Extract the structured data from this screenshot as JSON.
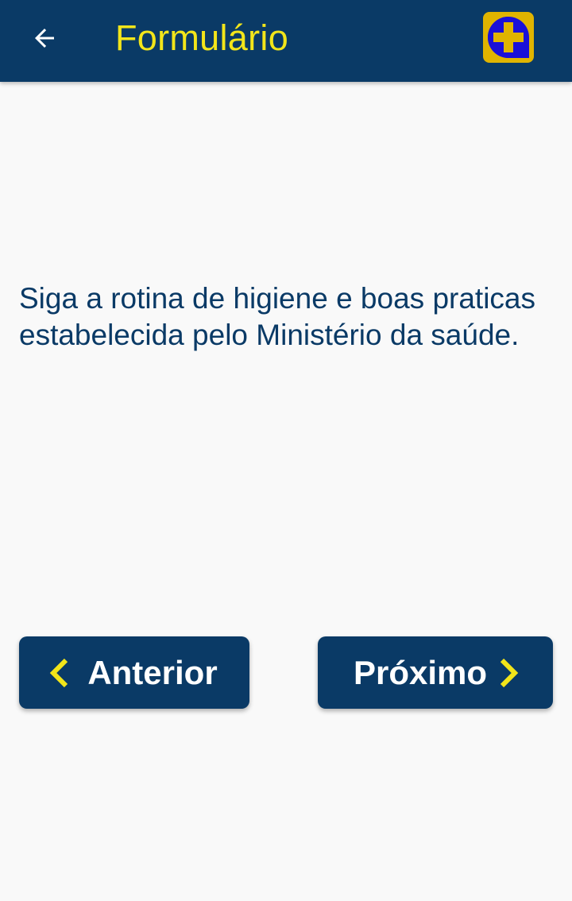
{
  "app_bar": {
    "title": "Formulário",
    "back_icon": "arrow-left-icon",
    "logo_icon": "medical-cross-logo-icon"
  },
  "content": {
    "message": "Siga a rotina de higiene e boas praticas estabelecida pelo Ministério da saúde."
  },
  "navigation": {
    "previous_label": "Anterior",
    "next_label": "Próximo",
    "previous_icon": "chevron-left-icon",
    "next_icon": "chevron-right-icon"
  },
  "colors": {
    "primary": "#0a3a66",
    "accent": "#f2e51a",
    "logo_blue": "#1a10d8",
    "logo_gold": "#e0b400",
    "background": "#f9f9f9"
  }
}
